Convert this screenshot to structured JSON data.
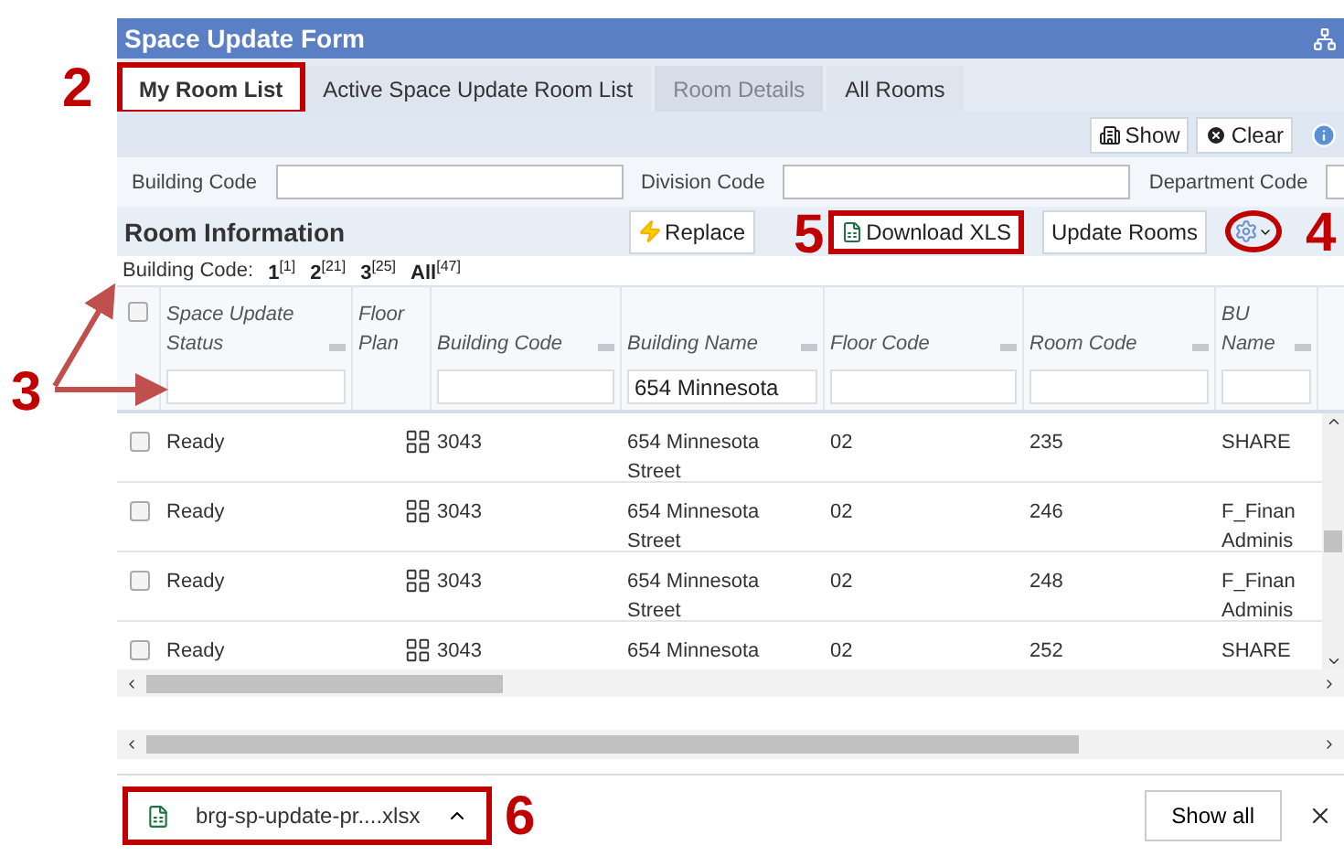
{
  "window": {
    "title": "Space Update Form"
  },
  "tabs": [
    {
      "label": "My Room List",
      "selected": true,
      "disabled": false,
      "highlighted": true
    },
    {
      "label": "Active Space Update Room List",
      "selected": false,
      "disabled": false,
      "highlighted": false
    },
    {
      "label": "Room Details",
      "selected": false,
      "disabled": true,
      "highlighted": false
    },
    {
      "label": "All Rooms",
      "selected": false,
      "disabled": false,
      "highlighted": false
    }
  ],
  "toolbar": {
    "show": "Show",
    "clear": "Clear"
  },
  "filters": [
    {
      "label": "Building Code"
    },
    {
      "label": "Division Code"
    },
    {
      "label": "Department Code"
    }
  ],
  "room_info": {
    "title": "Room Information",
    "replace": "Replace",
    "download": "Download XLS",
    "download_highlighted": true,
    "update": "Update Rooms",
    "gear_highlighted": true,
    "building_code_label": "Building Code:",
    "links": [
      {
        "label": "1",
        "count": "[1]"
      },
      {
        "label": "2",
        "count": "[21]"
      },
      {
        "label": "3",
        "count": "[25]"
      },
      {
        "label": "All",
        "count": "[47]"
      }
    ]
  },
  "table": {
    "select_all_checked": false,
    "columns": [
      {
        "label": "Space Update Status",
        "kind": "filter"
      },
      {
        "label": "Floor Plan",
        "kind": "plain"
      },
      {
        "label": "Building Code",
        "kind": "filter"
      },
      {
        "label": "Building Name",
        "kind": "filter",
        "filter_value": "654 Minnesota"
      },
      {
        "label": "Floor Code",
        "kind": "filter"
      },
      {
        "label": "Room Code",
        "kind": "filter"
      },
      {
        "label": "BU Name",
        "kind": "filter"
      }
    ],
    "rows": [
      {
        "checked": false,
        "status": "Ready",
        "building_code": "3043",
        "building_name": [
          "654 Minnesota",
          "Street"
        ],
        "floor_code": "02",
        "room_code": "235",
        "bu_name": [
          "SHARE"
        ]
      },
      {
        "checked": false,
        "status": "Ready",
        "building_code": "3043",
        "building_name": [
          "654 Minnesota",
          "Street"
        ],
        "floor_code": "02",
        "room_code": "246",
        "bu_name": [
          "F_Finan",
          "Adminis"
        ]
      },
      {
        "checked": false,
        "status": "Ready",
        "building_code": "3043",
        "building_name": [
          "654 Minnesota",
          "Street"
        ],
        "floor_code": "02",
        "room_code": "248",
        "bu_name": [
          "F_Finan",
          "Adminis"
        ]
      },
      {
        "checked": false,
        "status": "Ready",
        "building_code": "3043",
        "building_name": [
          "654 Minnesota"
        ],
        "floor_code": "02",
        "room_code": "252",
        "bu_name": [
          "SHARE"
        ]
      }
    ]
  },
  "download_bar": {
    "file": "brg-sp-update-pr....xlsx",
    "highlighted": true,
    "show_all": "Show all"
  },
  "annotations": [
    "2",
    "3",
    "4",
    "5",
    "6"
  ]
}
